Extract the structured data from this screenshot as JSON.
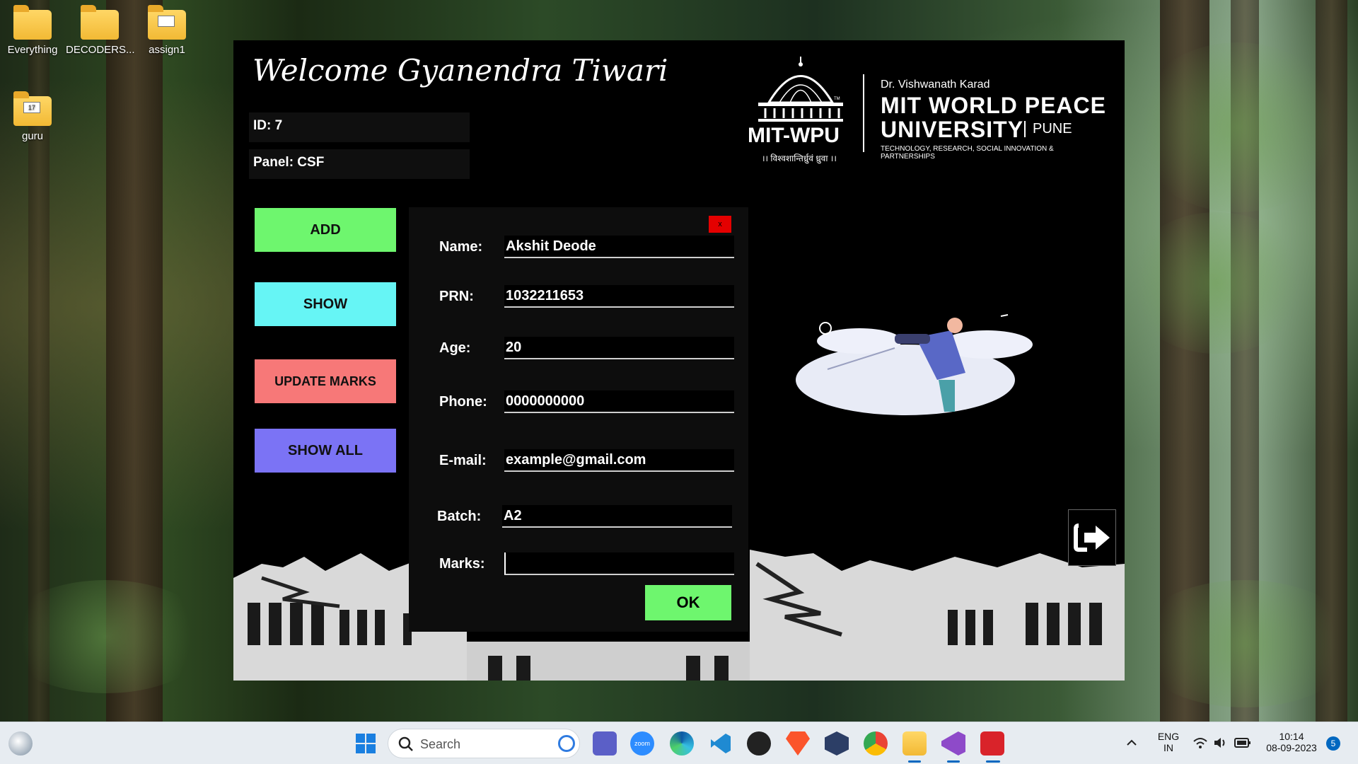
{
  "desktop": {
    "icons": [
      {
        "label": "Everything"
      },
      {
        "label": "DECODERS..."
      },
      {
        "label": "assign1"
      },
      {
        "label": "guru"
      }
    ]
  },
  "app": {
    "welcome": "Welcome Gyanendra Tiwari",
    "id_text": "ID: 7",
    "panel_text": "Panel: CSF",
    "logo": {
      "mitwpu": "MIT-WPU",
      "motto": "।। विश्वशान्तिर्ध्रुवं ध्रुवा ।।",
      "founder": "Dr. Vishwanath Karad",
      "line1": "MIT WORLD PEACE",
      "line2": "UNIVERSITY",
      "city": "PUNE",
      "tagline": "TECHNOLOGY, RESEARCH, SOCIAL INNOVATION & PARTNERSHIPS",
      "tm": "TM"
    },
    "buttons": {
      "add": "ADD",
      "show": "SHOW",
      "update": "UPDATE MARKS",
      "show_all": "SHOW ALL"
    },
    "colors": {
      "add": "#6ef66e",
      "show": "#66f5f5",
      "update": "#f77878",
      "show_all": "#7b73f5",
      "close": "#e40000"
    },
    "form": {
      "close_label": "x",
      "name_label": "Name:",
      "name_value": "Akshit Deode",
      "prn_label": "PRN:",
      "prn_value": "1032211653",
      "age_label": "Age:",
      "age_value": "20",
      "phone_label": "Phone:",
      "phone_value": "0000000000",
      "email_label": "E-mail:",
      "email_value": "example@gmail.com",
      "batch_label": "Batch:",
      "batch_value": "A2",
      "marks_label": "Marks:",
      "marks_value": "",
      "ok_label": "OK"
    }
  },
  "taskbar": {
    "search_placeholder": "Search",
    "lang_top": "ENG",
    "lang_bottom": "IN",
    "time": "10:14",
    "date": "08-09-2023",
    "notification_count": "5",
    "zoom_label": "zoom"
  }
}
